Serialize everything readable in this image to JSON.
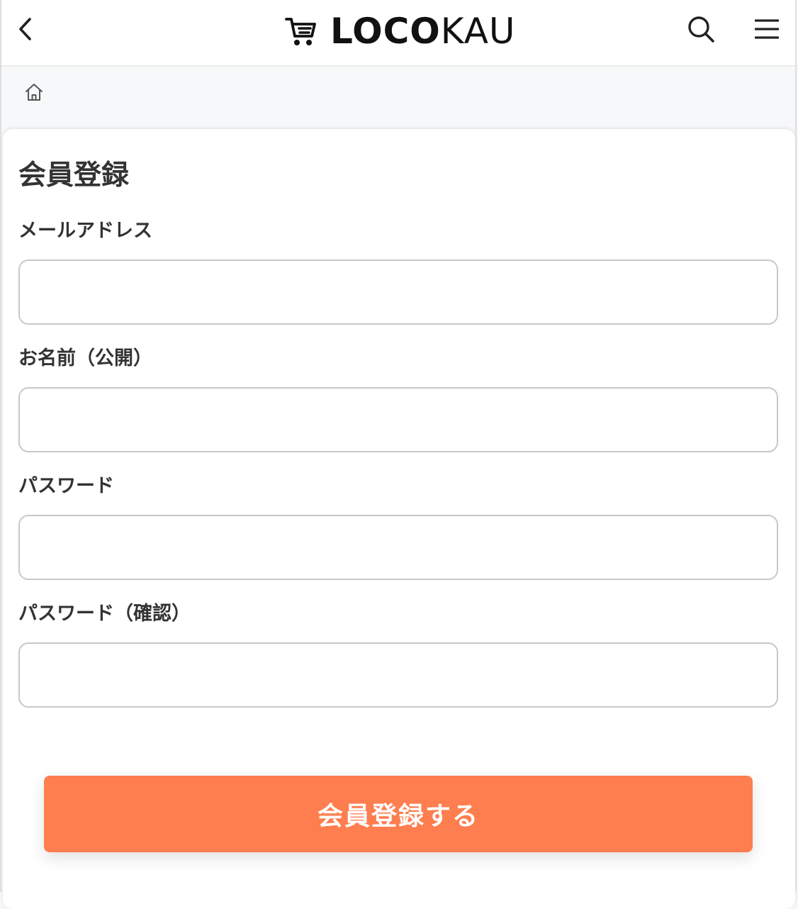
{
  "header": {
    "back_icon": "chevron-left-icon",
    "logo": {
      "icon": "cart-icon",
      "text_bold": "LOCO",
      "text_light": "KAU"
    },
    "search_icon": "search-icon",
    "menu_icon": "hamburger-menu-icon"
  },
  "breadcrumb": {
    "home_icon": "home-icon"
  },
  "form": {
    "title": "会員登録",
    "fields": [
      {
        "label": "メールアドレス",
        "value": "",
        "type": "email"
      },
      {
        "label": "お名前（公開）",
        "value": "",
        "type": "text"
      },
      {
        "label": "パスワード",
        "value": "",
        "type": "password"
      },
      {
        "label": "パスワード（確認）",
        "value": "",
        "type": "password"
      }
    ],
    "submit_label": "会員登録する"
  },
  "colors": {
    "accent": "#fe7e4f",
    "text": "#333333",
    "input_border": "#c8c8c8",
    "background": "#f7f8fa"
  }
}
